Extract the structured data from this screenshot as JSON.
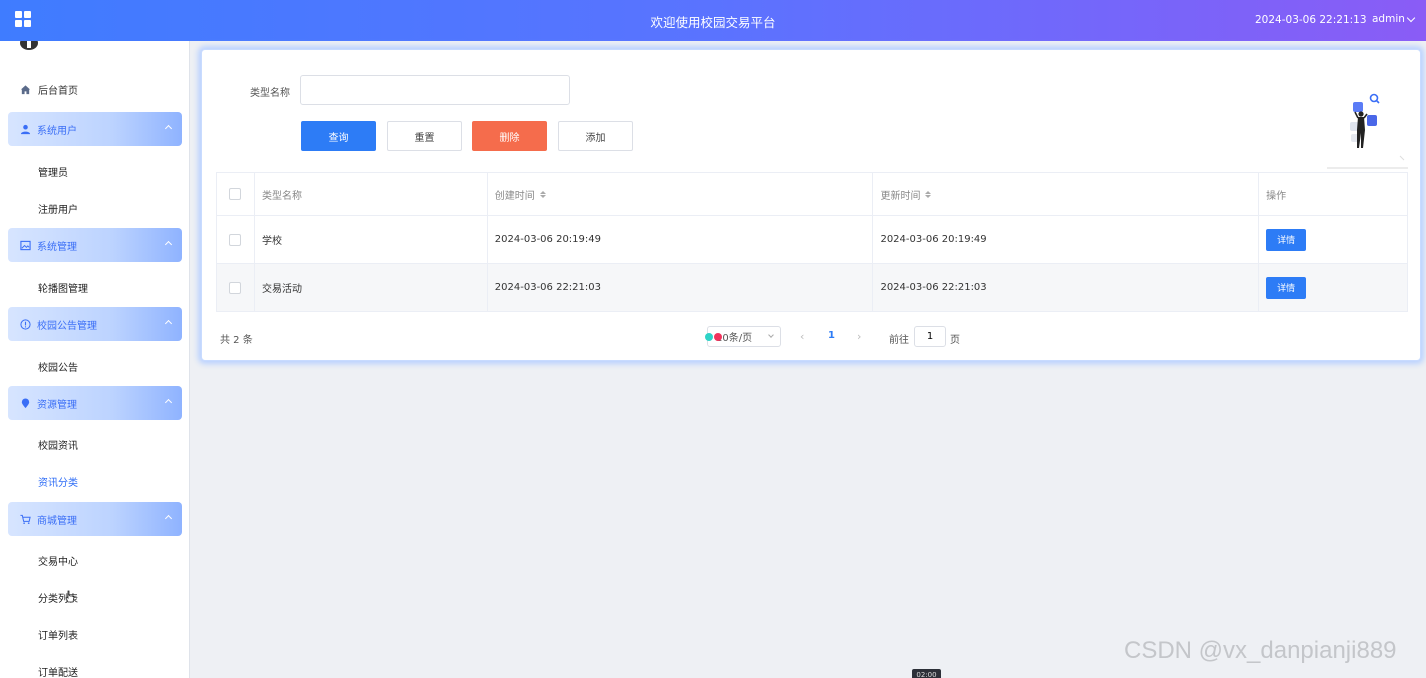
{
  "topbar": {
    "title": "欢迎使用校园交易平台",
    "datetime": "2024-03-06 22:21:13",
    "user": "admin"
  },
  "sidebar": {
    "home": "后台首页",
    "groups": [
      {
        "label": "系统用户",
        "icon": "user-icon",
        "items": [
          "管理员",
          "注册用户"
        ]
      },
      {
        "label": "系统管理",
        "icon": "image-icon",
        "items": [
          "轮播图管理"
        ]
      },
      {
        "label": "校园公告管理",
        "icon": "info-circle-icon",
        "items": [
          "校园公告"
        ]
      },
      {
        "label": "资源管理",
        "icon": "location-icon",
        "items": [
          "校园资讯",
          "资讯分类"
        ]
      },
      {
        "label": "商城管理",
        "icon": "cart-icon",
        "items": [
          "交易中心",
          "分类列表",
          "订单列表",
          "订单配送"
        ]
      }
    ],
    "active_item": "资讯分类"
  },
  "search": {
    "label": "类型名称",
    "value": "",
    "placeholder": ""
  },
  "buttons": {
    "search": "查询",
    "reset": "重置",
    "delete": "删除",
    "add": "添加"
  },
  "table": {
    "headers": [
      "类型名称",
      "创建时间",
      "更新时间",
      "操作"
    ],
    "rows": [
      {
        "name": "学校",
        "created": "2024-03-06 20:19:49",
        "updated": "2024-03-06 20:19:49",
        "action": "详情"
      },
      {
        "name": "交易活动",
        "created": "2024-03-06 22:21:03",
        "updated": "2024-03-06 22:21:03",
        "action": "详情"
      }
    ]
  },
  "pagination": {
    "total": "共 2 条",
    "page_size": "10条/页",
    "current_page": "1",
    "goto_label": "前往",
    "goto_value": "1",
    "goto_unit": "页"
  },
  "overlay": {
    "watermark": "CSDN @vx_danpianji889",
    "video_time": "02:00"
  },
  "colors": {
    "primary": "#2d7cf6",
    "danger": "#f56c4c",
    "topbar_start": "#3f7cff",
    "topbar_end": "#8a5cf6"
  }
}
